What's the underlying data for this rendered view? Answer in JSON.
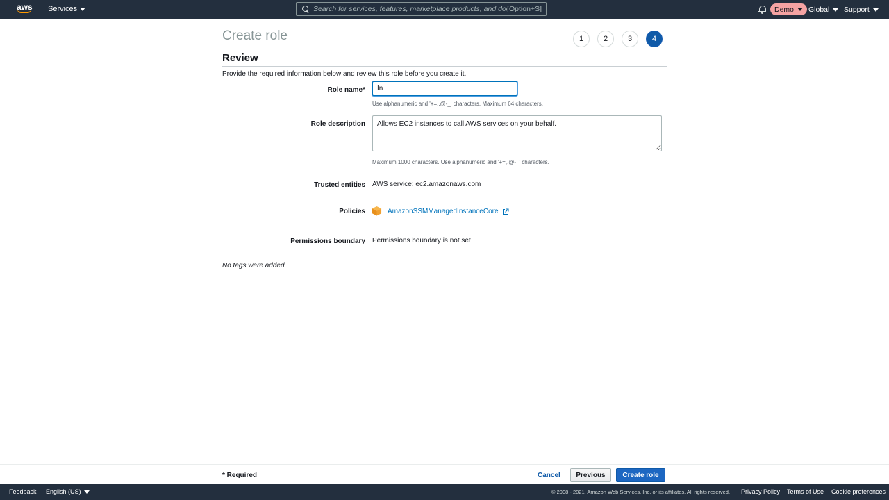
{
  "topnav": {
    "logo_text": "aws",
    "services_label": "Services",
    "search_placeholder": "Search for services, features, marketplace products, and docs",
    "search_shortcut": "[Option+S]",
    "account_label": "Demo",
    "region_label": "Global",
    "support_label": "Support",
    "account_pill_color": "#f5a3a3"
  },
  "header": {
    "title": "Create role",
    "steps": [
      "1",
      "2",
      "3",
      "4"
    ],
    "active_step": "4"
  },
  "review": {
    "section_title": "Review",
    "intro": "Provide the required information below and review this role before you create it."
  },
  "form": {
    "role_name_label": "Role name*",
    "role_name_value": "In",
    "role_name_hint": "Use alphanumeric and '+=,.@-_' characters. Maximum 64 characters.",
    "role_description_label": "Role description",
    "role_description_value": "Allows EC2 instances to call AWS services on your behalf.",
    "role_description_hint": "Maximum 1000 characters. Use alphanumeric and '+=,.@-_' characters.",
    "trusted_entities_label": "Trusted entities",
    "trusted_entities_value": "AWS service: ec2.amazonaws.com",
    "policies_label": "Policies",
    "policy_name": "AmazonSSMManagedInstanceCore",
    "permissions_boundary_label": "Permissions boundary",
    "permissions_boundary_value": "Permissions boundary is not set",
    "no_tags": "No tags were added."
  },
  "actions": {
    "required_note": "* Required",
    "cancel_label": "Cancel",
    "previous_label": "Previous",
    "create_label": "Create role",
    "primary_color": "#1d67c2"
  },
  "footer": {
    "feedback": "Feedback",
    "language": "English (US)",
    "copyright": "© 2008 - 2021, Amazon Web Services, Inc. or its affiliates. All rights reserved.",
    "privacy": "Privacy Policy",
    "terms": "Terms of Use",
    "cookies": "Cookie preferences"
  }
}
